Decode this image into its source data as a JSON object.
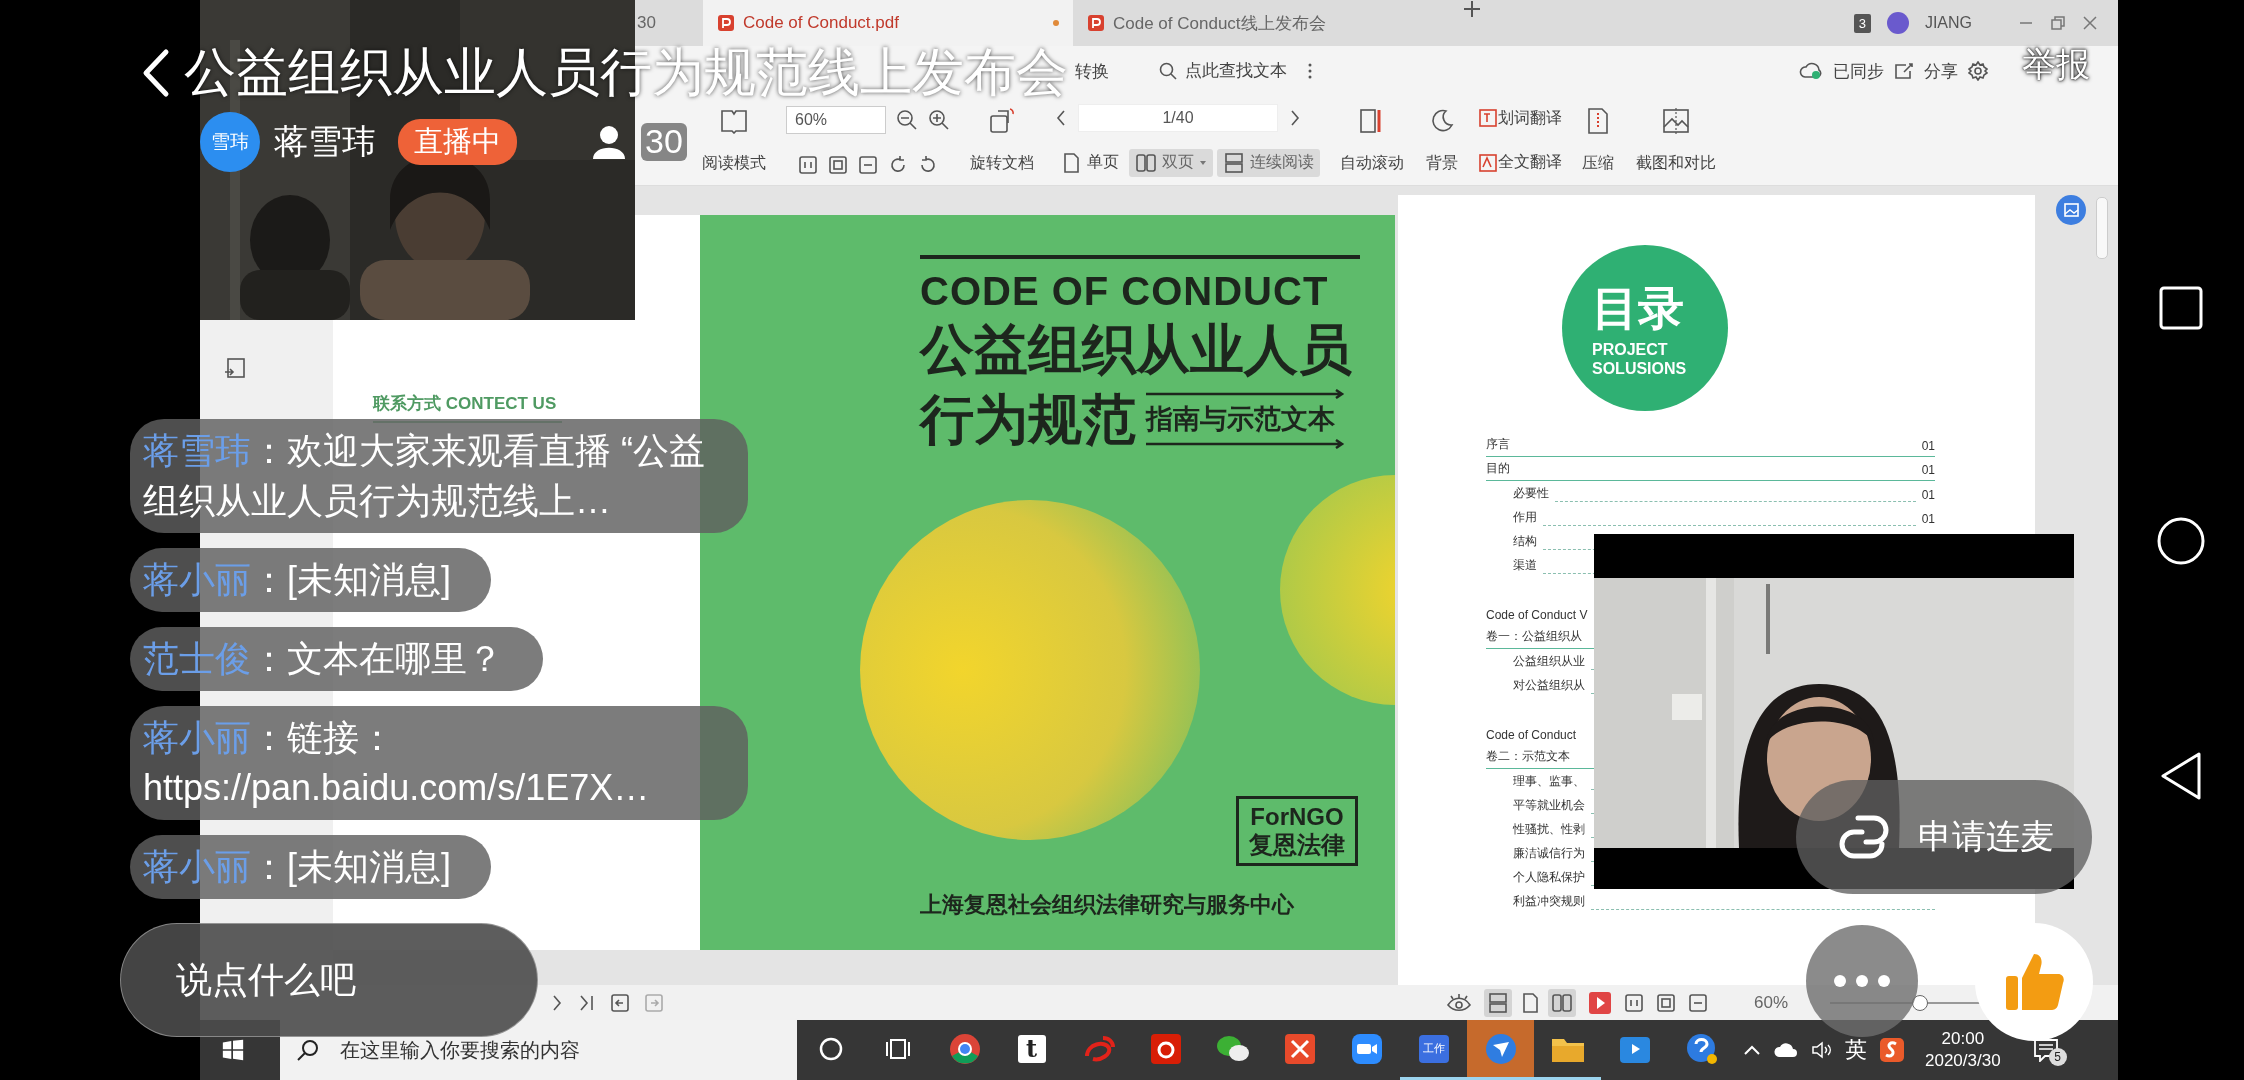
{
  "stream": {
    "title": "公益组织从业人员行为规范线上发布会",
    "avatar": "雪玮",
    "host": "蒋雪玮",
    "badge": "直播中",
    "viewers": "30",
    "report": "举报"
  },
  "tabs": [
    {
      "label": "30",
      "selected": false
    },
    {
      "label": "Code of Conduct.pdf",
      "selected": true
    },
    {
      "label": "Code of Conduct线上发布会",
      "selected": false
    }
  ],
  "account": {
    "count": "3",
    "name": "JIANG"
  },
  "toolbar": {
    "convert": "转换",
    "find_placeholder": "点此查找文本",
    "sync": "已同步",
    "share": "分享",
    "read_mode": "阅读模式",
    "zoom": "60%",
    "rotate": "旋转文档",
    "page": "1/40",
    "view_modes": [
      {
        "label": "单页",
        "selected": false
      },
      {
        "label": "双页",
        "selected": true
      },
      {
        "label": "连续阅读",
        "selected": true
      }
    ],
    "auto_scroll": "自动滚动",
    "background": "背景",
    "word_translate": "划词翻译",
    "full_translate": "全文翻译",
    "compress": "压缩",
    "compare": "截图和对比"
  },
  "document": {
    "contact_heading": "联系方式 CONTECT US",
    "cover": {
      "title_en": "CODE OF CONDUCT",
      "title_line1": "公益组织从业人员",
      "title_line2": "行为规范",
      "subtitle": "指南与示范文本",
      "logo_en": "ForNGO",
      "logo_cn": "复恩法律",
      "publisher": "上海复恩社会组织法律研究与服务中心"
    },
    "toc": {
      "heading": "目录",
      "heading_en": [
        "PROJECT",
        "SOLUSIONS"
      ],
      "entries": [
        {
          "kind": "entry",
          "title": "序言",
          "page": "01"
        },
        {
          "kind": "entry",
          "title": "目的",
          "page": "01",
          "children": [
            {
              "title": "必要性",
              "page": "01"
            },
            {
              "title": "作用",
              "page": "01"
            },
            {
              "title": "结构"
            },
            {
              "title": "渠道"
            }
          ]
        },
        {
          "kind": "group",
          "title": "Code of Conduct V"
        },
        {
          "kind": "entry",
          "title": "卷一：公益组织从",
          "children": [
            {
              "title": "公益组织从业"
            },
            {
              "title": "对公益组织从"
            }
          ]
        },
        {
          "kind": "group",
          "title": "Code of Conduct"
        },
        {
          "kind": "entry",
          "title": "卷二：示范文本",
          "children": [
            {
              "title": "理事、监事、"
            },
            {
              "title": "平等就业机会"
            },
            {
              "title": "性骚扰、性剥"
            },
            {
              "title": "廉洁诚信行为"
            },
            {
              "title": "个人隐私保护"
            },
            {
              "title": "利益冲突规则"
            }
          ]
        }
      ]
    }
  },
  "status_bar": {
    "view_modes": [
      {
        "selected": true
      },
      {
        "selected": false
      },
      {
        "selected": true
      }
    ],
    "zoom": "60%",
    "level": 0.45
  },
  "taskbar": {
    "search_placeholder": "在这里输入你要搜索的内容",
    "apps": [
      {
        "kind": "cortana",
        "selected": false,
        "running": false
      },
      {
        "kind": "taskview",
        "selected": false,
        "running": false
      },
      {
        "kind": "chrome",
        "selected": false,
        "running": false
      },
      {
        "kind": "letter",
        "label": "t",
        "selected": false,
        "running": false
      },
      {
        "kind": "weibo",
        "selected": false,
        "running": false
      },
      {
        "kind": "music",
        "selected": false,
        "running": false
      },
      {
        "kind": "wechat",
        "selected": false,
        "running": false
      },
      {
        "kind": "cross",
        "selected": false,
        "running": false
      },
      {
        "kind": "camera",
        "selected": false,
        "running": false
      },
      {
        "kind": "work",
        "label": "工作",
        "selected": false,
        "running": true
      },
      {
        "kind": "bird",
        "selected": true,
        "running": true
      },
      {
        "kind": "folder",
        "selected": false,
        "running": true
      },
      {
        "kind": "tv",
        "selected": false,
        "running": false
      },
      {
        "kind": "help",
        "selected": false,
        "running": false
      }
    ],
    "lang": "英",
    "time": "20:00",
    "date": "2020/3/30",
    "notifications": "5"
  },
  "chat": [
    {
      "name": "蒋雪玮",
      "separator": "：",
      "text": "欢迎大家来观看直播 “公益组织从业人员行为规范线上…"
    },
    {
      "name": "蒋小丽",
      "separator": "：",
      "text": "[未知消息]"
    },
    {
      "name": "范士俊",
      "separator": "：",
      "text": "文本在哪里？"
    },
    {
      "name": "蒋小丽",
      "separator": "：",
      "text": "链接：https://pan.baidu.com/s/1E7X…"
    },
    {
      "name": "蒋小丽",
      "separator": "：",
      "text": "[未知消息]"
    }
  ],
  "comment_placeholder": "说点什么吧",
  "mic_request": "申请连麦"
}
